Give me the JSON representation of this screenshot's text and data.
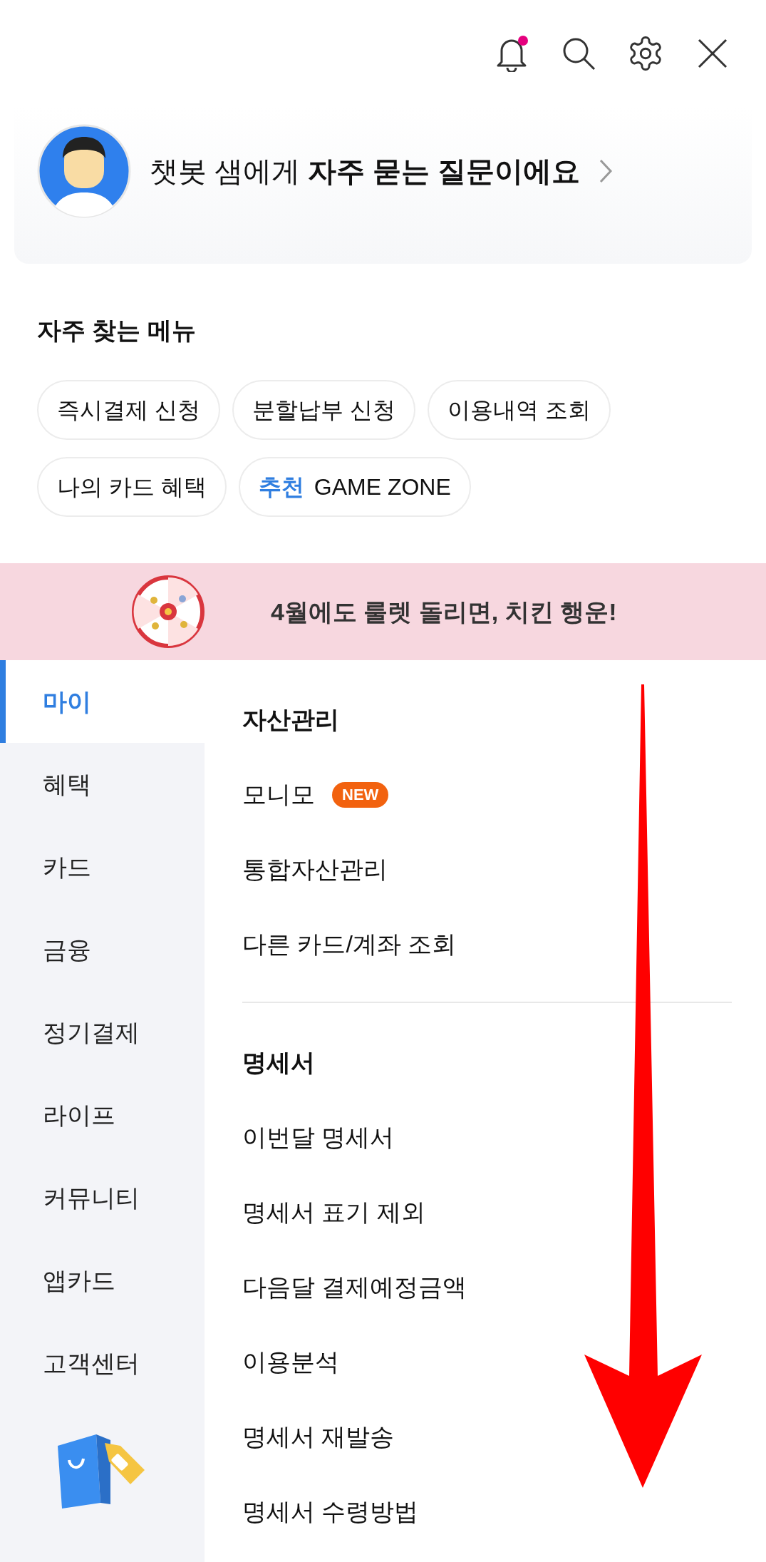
{
  "header": {
    "notification": {
      "unread": true
    }
  },
  "chatbot": {
    "text": "챗봇 샘에게 **자주 묻는 질문이에요**"
  },
  "frequent_menu": {
    "title": "자주 찾는 메뉴",
    "chips": [
      {
        "label": "즉시결제 신청"
      },
      {
        "label": "분할납부 신청"
      },
      {
        "label": "이용내역 조회"
      },
      {
        "label": "나의 카드 혜택"
      },
      {
        "label": "GAME ZONE",
        "tag": "추천"
      }
    ]
  },
  "promo_banner": {
    "text": "4월에도 룰렛 돌리면, 치킨 행운!"
  },
  "sidebar": {
    "items": [
      {
        "label": "마이",
        "selected": true
      },
      {
        "label": "혜택",
        "selected": false
      },
      {
        "label": "카드",
        "selected": false
      },
      {
        "label": "금융",
        "selected": false
      },
      {
        "label": "정기결제",
        "selected": false
      },
      {
        "label": "라이프",
        "selected": false
      },
      {
        "label": "커뮤니티",
        "selected": false
      },
      {
        "label": "앱카드",
        "selected": false
      },
      {
        "label": "고객센터",
        "selected": false
      }
    ]
  },
  "sections": [
    {
      "title": "자산관리",
      "items": [
        {
          "label": "모니모",
          "badge": "NEW"
        },
        {
          "label": "통합자산관리"
        },
        {
          "label": "다른 카드/계좌 조회"
        }
      ]
    },
    {
      "title": "명세서",
      "items": [
        {
          "label": "이번달 명세서"
        },
        {
          "label": "명세서 표기 제외"
        },
        {
          "label": "다음달 결제예정금액"
        },
        {
          "label": "이용분석"
        },
        {
          "label": "명세서 재발송"
        },
        {
          "label": "명세서 수령방법"
        }
      ]
    }
  ],
  "annotation": {
    "kind": "arrow"
  }
}
